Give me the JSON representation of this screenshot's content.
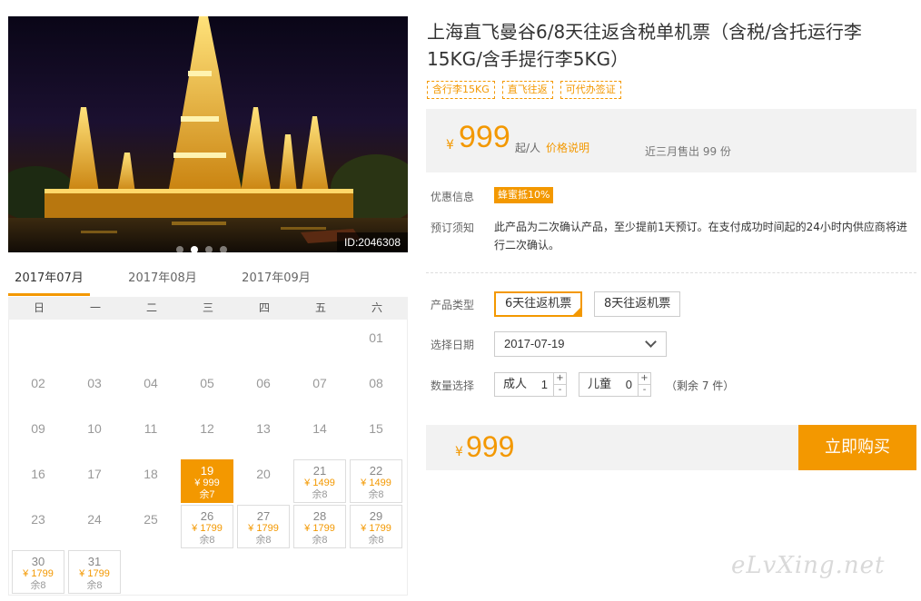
{
  "photo": {
    "id_label": "ID:2046308",
    "slides": 4,
    "active_slide": 2
  },
  "calendar": {
    "months": [
      "2017年07月",
      "2017年08月",
      "2017年09月"
    ],
    "active_month": 0,
    "weekdays": [
      "日",
      "一",
      "二",
      "三",
      "四",
      "五",
      "六"
    ],
    "first_weekday": 6,
    "days": [
      {
        "d": "01"
      },
      {
        "d": "02"
      },
      {
        "d": "03"
      },
      {
        "d": "04"
      },
      {
        "d": "05"
      },
      {
        "d": "06"
      },
      {
        "d": "07"
      },
      {
        "d": "08"
      },
      {
        "d": "09"
      },
      {
        "d": "10"
      },
      {
        "d": "11"
      },
      {
        "d": "12"
      },
      {
        "d": "13"
      },
      {
        "d": "14"
      },
      {
        "d": "15"
      },
      {
        "d": "16"
      },
      {
        "d": "17"
      },
      {
        "d": "18"
      },
      {
        "d": "19",
        "price": "¥ 999",
        "stock": "余7",
        "selected": true
      },
      {
        "d": "20"
      },
      {
        "d": "21",
        "price": "¥ 1499",
        "stock": "余8"
      },
      {
        "d": "22",
        "price": "¥ 1499",
        "stock": "余8"
      },
      {
        "d": "23"
      },
      {
        "d": "24"
      },
      {
        "d": "25"
      },
      {
        "d": "26",
        "price": "¥ 1799",
        "stock": "余8"
      },
      {
        "d": "27",
        "price": "¥ 1799",
        "stock": "余8"
      },
      {
        "d": "28",
        "price": "¥ 1799",
        "stock": "余8"
      },
      {
        "d": "29",
        "price": "¥ 1799",
        "stock": "余8"
      },
      {
        "d": "30",
        "price": "¥ 1799",
        "stock": "余8"
      },
      {
        "d": "31",
        "price": "¥ 1799",
        "stock": "余8"
      }
    ]
  },
  "product": {
    "title": "上海直飞曼谷6/8天往返含税单机票（含税/含托运行李15KG/含手提行李5KG）",
    "tags": [
      "含行李15KG",
      "直飞往返",
      "可代办签证"
    ],
    "price": {
      "currency": "¥",
      "amount": "999",
      "suffix": "起/人",
      "explain_link": "价格说明",
      "sold": "近三月售出 99 份"
    },
    "promo_label": "优惠信息",
    "promo_badge": "蜂蜜抵10%",
    "notice_label": "预订须知",
    "notice_text": "此产品为二次确认产品，至少提前1天预订。在支付成功时间起的24小时内供应商将进行二次确认。"
  },
  "form": {
    "type_label": "产品类型",
    "types": [
      "6天往返机票",
      "8天往返机票"
    ],
    "selected_type": 0,
    "date_label": "选择日期",
    "date_value": "2017-07-19",
    "qty_label": "数量选择",
    "adult_label": "成人",
    "adult_value": "1",
    "child_label": "儿童",
    "child_value": "0",
    "plus": "+",
    "minus": "-",
    "remaining": "（剩余 7 件）"
  },
  "total": {
    "currency": "¥",
    "amount": "999",
    "buy_label": "立即购买"
  },
  "watermark": "eLvXing.net",
  "colors": {
    "accent": "#f39800",
    "panel": "#f2f2f2"
  }
}
